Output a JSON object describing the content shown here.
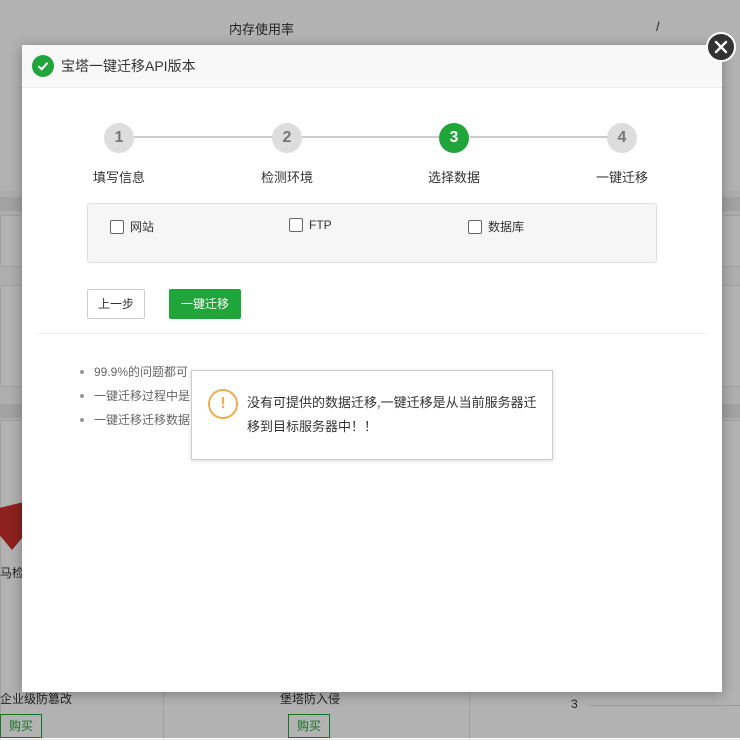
{
  "background": {
    "memory_label": "内存使用率",
    "slash": "/",
    "shield_label": "马检",
    "left_caption": "企业级防篡改",
    "mid_caption": "堡塔防入侵",
    "buy_label": "购买",
    "axis_tick": "3"
  },
  "modal": {
    "title": "宝塔一键迁移API版本",
    "steps": [
      {
        "number": "1",
        "label": "填写信息"
      },
      {
        "number": "2",
        "label": "检测环境"
      },
      {
        "number": "3",
        "label": "选择数据"
      },
      {
        "number": "4",
        "label": "一键迁移"
      }
    ],
    "active_step": 3,
    "options": [
      {
        "label": "网站",
        "checked": false
      },
      {
        "label": "FTP",
        "checked": false
      },
      {
        "label": "数据库",
        "checked": false
      }
    ],
    "prev_button": "上一步",
    "migrate_button": "一键迁移",
    "notes": [
      "99.9%的问题都可",
      "一键迁移过程中是",
      "一键迁移迁移数据"
    ]
  },
  "alert": {
    "message": "没有可提供的数据迁移,一键迁移是从当前服务器迁移到目标服务器中！！"
  },
  "colors": {
    "accent": "#20a53a",
    "warning": "#f0ad4e"
  }
}
